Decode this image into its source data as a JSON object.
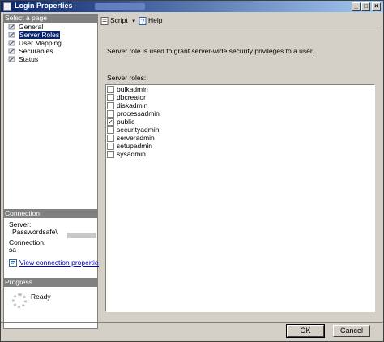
{
  "window": {
    "title": "Login Properties - "
  },
  "left": {
    "select_page_header": "Select a page",
    "pages": [
      {
        "label": "General"
      },
      {
        "label": "Server Roles"
      },
      {
        "label": "User Mapping"
      },
      {
        "label": "Securables"
      },
      {
        "label": "Status"
      }
    ],
    "connection_header": "Connection",
    "server_label": "Server:",
    "server_value": "Passwordsafe\\",
    "connection_label": "Connection:",
    "connection_value": "sa",
    "view_link": "View connection properties",
    "progress_header": "Progress",
    "progress_status": "Ready"
  },
  "toolbar": {
    "script_label": "Script",
    "help_label": "Help"
  },
  "main": {
    "description": "Server role is used to grant server-wide security privileges to a user.",
    "roles_label": "Server roles:",
    "roles": [
      {
        "label": "bulkadmin",
        "checked": false
      },
      {
        "label": "dbcreator",
        "checked": false
      },
      {
        "label": "diskadmin",
        "checked": false
      },
      {
        "label": "processadmin",
        "checked": false
      },
      {
        "label": "public",
        "checked": true
      },
      {
        "label": "securityadmin",
        "checked": false
      },
      {
        "label": "serveradmin",
        "checked": false
      },
      {
        "label": "setupadmin",
        "checked": false
      },
      {
        "label": "sysadmin",
        "checked": false
      }
    ]
  },
  "buttons": {
    "ok": "OK",
    "cancel": "Cancel"
  }
}
